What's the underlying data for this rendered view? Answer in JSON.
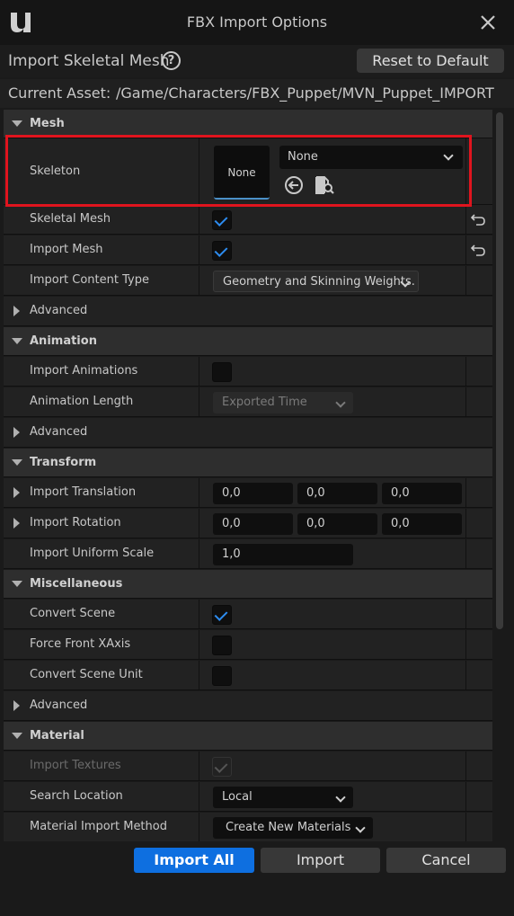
{
  "window": {
    "title": "FBX Import Options"
  },
  "header": {
    "type_label": "Import Skeletal Mesh",
    "reset_label": "Reset to Default",
    "asset_label": "Current Asset:",
    "asset_path": "/Game/Characters/FBX_Puppet/MVN_Puppet_IMPORT"
  },
  "sections": {
    "mesh": "Mesh",
    "animation": "Animation",
    "transform": "Transform",
    "miscellaneous": "Miscellaneous",
    "material": "Material"
  },
  "mesh": {
    "skeleton_label": "Skeleton",
    "skeleton_thumb": "None",
    "skeleton_value": "None",
    "skeletal_mesh_label": "Skeletal Mesh",
    "skeletal_mesh_checked": true,
    "import_mesh_label": "Import Mesh",
    "import_mesh_checked": true,
    "content_type_label": "Import Content Type",
    "content_type_value": "Geometry and Skinning Weights.",
    "advanced_label": "Advanced"
  },
  "animation": {
    "import_animations_label": "Import Animations",
    "import_animations_checked": false,
    "animation_length_label": "Animation Length",
    "animation_length_value": "Exported Time",
    "advanced_label": "Advanced"
  },
  "transform": {
    "translation_label": "Import Translation",
    "translation": [
      "0,0",
      "0,0",
      "0,0"
    ],
    "rotation_label": "Import Rotation",
    "rotation": [
      "0,0",
      "0,0",
      "0,0"
    ],
    "uniform_scale_label": "Import Uniform Scale",
    "uniform_scale": "1,0"
  },
  "misc": {
    "convert_scene_label": "Convert Scene",
    "convert_scene_checked": true,
    "force_front_label": "Force Front XAxis",
    "force_front_checked": false,
    "convert_unit_label": "Convert Scene Unit",
    "convert_unit_checked": false,
    "advanced_label": "Advanced"
  },
  "material": {
    "import_textures_label": "Import Textures",
    "import_textures_checked": true,
    "search_location_label": "Search Location",
    "search_location_value": "Local",
    "import_method_label": "Material Import Method",
    "import_method_value": "Create New Materials"
  },
  "footer": {
    "import_all": "Import All",
    "import": "Import",
    "cancel": "Cancel"
  },
  "colors": {
    "accent": "#0e6fe0",
    "check": "#2d8cf0",
    "highlight": "#e0141e"
  }
}
